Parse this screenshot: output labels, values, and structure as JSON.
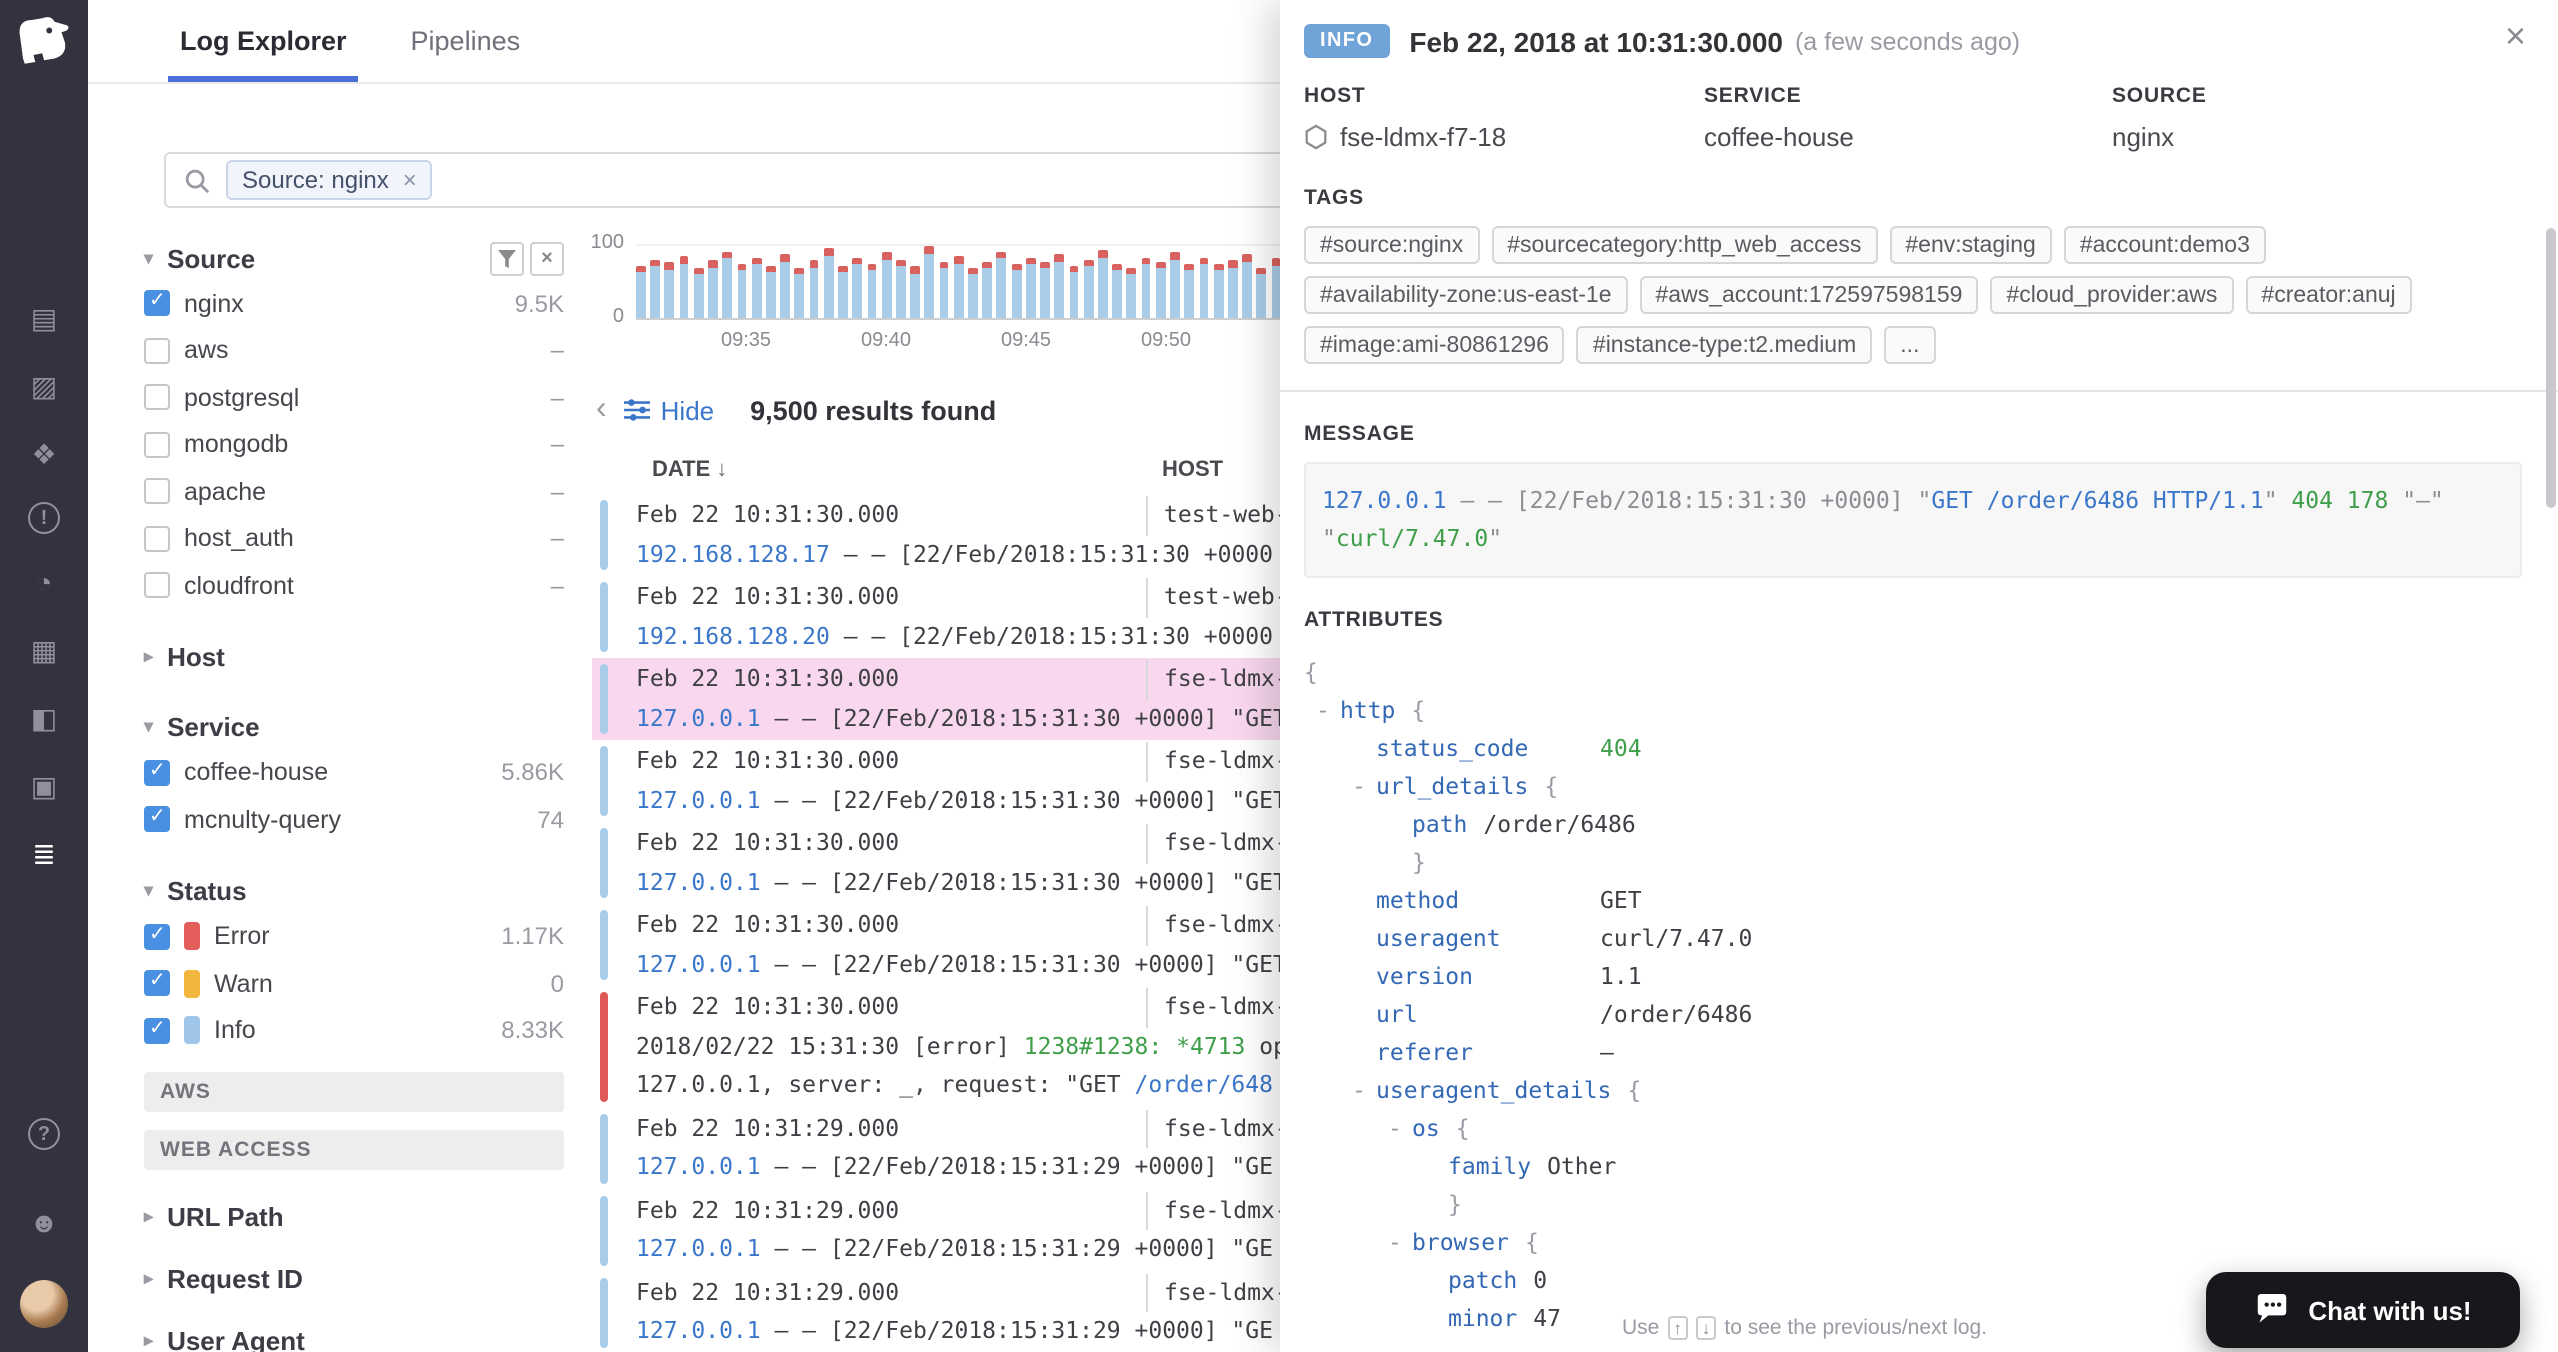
{
  "ui": {
    "chevron_down": "▾",
    "chevron_right": "▸",
    "chevron_left": "‹",
    "close": "×",
    "sort_down": "↓",
    "pill_close": "×",
    "funnel_tooltip": "filter"
  },
  "sidebar": {
    "icons": [
      {
        "name": "boards-icon",
        "glyph": "▤"
      },
      {
        "name": "metrics-icon",
        "glyph": "▨"
      },
      {
        "name": "infrastructure-icon",
        "glyph": "❖"
      },
      {
        "name": "monitors-icon",
        "glyph": "!",
        "circled": true
      },
      {
        "name": "dashboards-icon",
        "glyph": "◔"
      },
      {
        "name": "integrations-icon",
        "glyph": "▦"
      },
      {
        "name": "apm-icon",
        "glyph": "◧"
      },
      {
        "name": "notebooks-icon",
        "glyph": "▣"
      },
      {
        "name": "logs-icon",
        "glyph": "≣",
        "active": true
      }
    ],
    "bottom_icons": [
      {
        "name": "help-icon",
        "glyph": "?",
        "circled": true
      },
      {
        "name": "org-settings-icon",
        "glyph": "☻"
      }
    ]
  },
  "tabs": {
    "log_explorer": "Log Explorer",
    "pipelines": "Pipelines"
  },
  "search": {
    "filter_tag": "Source: nginx"
  },
  "facets": {
    "source": {
      "title": "Source",
      "items": [
        {
          "label": "nginx",
          "count": "9.5K",
          "checked": true
        },
        {
          "label": "aws",
          "count": "–",
          "checked": false
        },
        {
          "label": "postgresql",
          "count": "–",
          "checked": false
        },
        {
          "label": "mongodb",
          "count": "–",
          "checked": false
        },
        {
          "label": "apache",
          "count": "–",
          "checked": false
        },
        {
          "label": "host_auth",
          "count": "–",
          "checked": false
        },
        {
          "label": "cloudfront",
          "count": "–",
          "checked": false
        }
      ]
    },
    "host": {
      "title": "Host"
    },
    "service": {
      "title": "Service",
      "items": [
        {
          "label": "coffee-house",
          "count": "5.86K",
          "checked": true
        },
        {
          "label": "mcnulty-query",
          "count": "74",
          "checked": true
        }
      ]
    },
    "status": {
      "title": "Status",
      "items": [
        {
          "label": "Error",
          "count": "1.17K",
          "checked": true,
          "color": "#e25d5b"
        },
        {
          "label": "Warn",
          "count": "0",
          "checked": true,
          "color": "#f2b63d"
        },
        {
          "label": "Info",
          "count": "8.33K",
          "checked": true,
          "color": "#9fc6e8"
        }
      ]
    },
    "group_aws": "AWS",
    "group_web": "WEB ACCESS",
    "url_path": "URL Path",
    "request_id": "Request ID",
    "user_agent": "User Agent"
  },
  "chart": {
    "type": "bar",
    "y_max": "100",
    "y_min": "0",
    "x_ticks": [
      "09:35",
      "09:40",
      "09:45",
      "09:50"
    ],
    "series": [
      "info",
      "error"
    ],
    "bars": [
      [
        60,
        9
      ],
      [
        68,
        8
      ],
      [
        63,
        10
      ],
      [
        72,
        9
      ],
      [
        58,
        8
      ],
      [
        66,
        10
      ],
      [
        79,
        9
      ],
      [
        64,
        8
      ],
      [
        70,
        10
      ],
      [
        61,
        8
      ],
      [
        74,
        9
      ],
      [
        57,
        8
      ],
      [
        67,
        10
      ],
      [
        82,
        11
      ],
      [
        60,
        8
      ],
      [
        70,
        9
      ],
      [
        64,
        8
      ],
      [
        76,
        10
      ],
      [
        68,
        8
      ],
      [
        59,
        9
      ],
      [
        83,
        11
      ],
      [
        66,
        8
      ],
      [
        72,
        9
      ],
      [
        58,
        8
      ],
      [
        65,
        9
      ],
      [
        78,
        10
      ],
      [
        62,
        8
      ],
      [
        70,
        9
      ],
      [
        66,
        8
      ],
      [
        74,
        10
      ],
      [
        60,
        8
      ],
      [
        68,
        9
      ],
      [
        80,
        10
      ],
      [
        63,
        8
      ],
      [
        58,
        8
      ],
      [
        71,
        9
      ],
      [
        66,
        8
      ],
      [
        76,
        10
      ],
      [
        62,
        8
      ],
      [
        70,
        9
      ],
      [
        64,
        8
      ],
      [
        67,
        9
      ],
      [
        73,
        10
      ],
      [
        59,
        8
      ],
      [
        69,
        9
      ],
      [
        65,
        8
      ]
    ]
  },
  "results": {
    "hide_label": "Hide",
    "count": "9,500 results found",
    "col_date": "DATE",
    "col_host": "HOST"
  },
  "logs": [
    {
      "status": "info",
      "date": "Feb 22 10:31:30.000",
      "host": "test-web-",
      "lines": [
        [
          {
            "t": "192.168.128.17",
            "c": "ip"
          },
          {
            "t": " – – [22/Feb/2018:15:31:30 +0000",
            "c": "plain"
          }
        ]
      ]
    },
    {
      "status": "info",
      "date": "Feb 22 10:31:30.000",
      "host": "test-web-",
      "lines": [
        [
          {
            "t": "192.168.128.20",
            "c": "ip"
          },
          {
            "t": " – – [22/Feb/2018:15:31:30 +0000",
            "c": "plain"
          }
        ]
      ]
    },
    {
      "status": "info",
      "selected": true,
      "date": "Feb 22 10:31:30.000",
      "host": "fse-ldmx-",
      "lines": [
        [
          {
            "t": "127.0.0.1",
            "c": "ip"
          },
          {
            "t": " – – [22/Feb/2018:15:31:30 +0000] \"GET",
            "c": "plain"
          }
        ]
      ]
    },
    {
      "status": "info",
      "date": "Feb 22 10:31:30.000",
      "host": "fse-ldmx-",
      "lines": [
        [
          {
            "t": "127.0.0.1",
            "c": "ip"
          },
          {
            "t": " – – [22/Feb/2018:15:31:30 +0000] \"GET",
            "c": "plain"
          }
        ]
      ]
    },
    {
      "status": "info",
      "date": "Feb 22 10:31:30.000",
      "host": "fse-ldmx-",
      "lines": [
        [
          {
            "t": "127.0.0.1",
            "c": "ip"
          },
          {
            "t": " – – [22/Feb/2018:15:31:30 +0000] \"GET",
            "c": "plain"
          }
        ]
      ]
    },
    {
      "status": "info",
      "date": "Feb 22 10:31:30.000",
      "host": "fse-ldmx-",
      "lines": [
        [
          {
            "t": "127.0.0.1",
            "c": "ip"
          },
          {
            "t": " – – [22/Feb/2018:15:31:30 +0000] \"GET",
            "c": "plain"
          }
        ]
      ]
    },
    {
      "status": "error",
      "date": "Feb 22 10:31:30.000",
      "host": "fse-ldmx-",
      "lines": [
        [
          {
            "t": "2018/02/22 15:31:30 [error] ",
            "c": "plain"
          },
          {
            "t": "1238#1238:",
            "c": "green"
          },
          {
            "t": " ",
            "c": "plain"
          },
          {
            "t": "*4713",
            "c": "green"
          },
          {
            "t": " op",
            "c": "plain"
          }
        ],
        [
          {
            "t": "127.0.0.1",
            "c": "plain"
          },
          {
            "t": ", server: _, request: \"GET ",
            "c": "plain"
          },
          {
            "t": "/order/648",
            "c": "link"
          }
        ]
      ]
    },
    {
      "status": "info",
      "date": "Feb 22 10:31:29.000",
      "host": "fse-ldmx-",
      "lines": [
        [
          {
            "t": "127.0.0.1",
            "c": "ip"
          },
          {
            "t": " – – [22/Feb/2018:15:31:29 +0000] \"GE",
            "c": "plain"
          }
        ]
      ]
    },
    {
      "status": "info",
      "date": "Feb 22 10:31:29.000",
      "host": "fse-ldmx-",
      "lines": [
        [
          {
            "t": "127.0.0.1",
            "c": "ip"
          },
          {
            "t": " – – [22/Feb/2018:15:31:29 +0000] \"GE",
            "c": "plain"
          }
        ]
      ]
    },
    {
      "status": "info",
      "date": "Feb 22 10:31:29.000",
      "host": "fse-ldmx-",
      "lines": [
        [
          {
            "t": "127.0.0.1",
            "c": "ip"
          },
          {
            "t": " – – [22/Feb/2018:15:31:29 +0000] \"GE",
            "c": "plain"
          }
        ]
      ]
    }
  ],
  "detail": {
    "level_badge": "INFO",
    "timestamp": "Feb 22, 2018 at 10:31:30.000",
    "relative_time": "(a few seconds ago)",
    "meta": {
      "host_label": "HOST",
      "host": "fse-ldmx-f7-18",
      "service_label": "SERVICE",
      "service": "coffee-house",
      "source_label": "SOURCE",
      "source": "nginx"
    },
    "tags_label": "TAGS",
    "tags": [
      "#source:nginx",
      "#sourcecategory:http_web_access",
      "#env:staging",
      "#account:demo3",
      "#availability-zone:us-east-1e",
      "#aws_account:172597598159",
      "#cloud_provider:aws",
      "#creator:anuj",
      "#image:ami-80861296",
      "#instance-type:t2.medium",
      "..."
    ],
    "message_label": "MESSAGE",
    "message_segments": [
      {
        "t": "127.0.0.1",
        "c": "ip"
      },
      {
        "t": " – – ",
        "c": "dim"
      },
      {
        "t": "[22/Feb/2018:15:31:30 +0000]",
        "c": "dim"
      },
      {
        "t": " \"",
        "c": "dim"
      },
      {
        "t": "GET /order/6486 HTTP/1.1",
        "c": "link"
      },
      {
        "t": "\" ",
        "c": "dim"
      },
      {
        "t": "404 178",
        "c": "num"
      },
      {
        "t": " \"–\" \"",
        "c": "dim"
      },
      {
        "t": "curl/7.47.0",
        "c": "num"
      },
      {
        "t": "\"",
        "c": "dim"
      }
    ],
    "attributes_label": "ATTRIBUTES",
    "attributes": [
      {
        "indent": 0,
        "punct": "{"
      },
      {
        "indent": 1,
        "toggle": true,
        "key": "http",
        "open": "{"
      },
      {
        "indent": 2,
        "key": "status_code",
        "val": "404",
        "vc": "num",
        "col": true
      },
      {
        "indent": 2,
        "toggle": true,
        "key": "url_details",
        "open": "{"
      },
      {
        "indent": 3,
        "key": "path",
        "val": "/order/6486"
      },
      {
        "indent": 3,
        "punct": "}"
      },
      {
        "indent": 2,
        "key": "method",
        "val": "GET",
        "col": true
      },
      {
        "indent": 2,
        "key": "useragent",
        "val": "curl/7.47.0",
        "col": true
      },
      {
        "indent": 2,
        "key": "version",
        "val": "1.1",
        "col": true
      },
      {
        "indent": 2,
        "key": "url",
        "val": "/order/6486",
        "col": true
      },
      {
        "indent": 2,
        "key": "referer",
        "val": "–",
        "col": true
      },
      {
        "indent": 2,
        "toggle": true,
        "key": "useragent_details",
        "open": "{"
      },
      {
        "indent": 3,
        "toggle": true,
        "key": "os",
        "open": "{"
      },
      {
        "indent": 4,
        "key": "family",
        "val": "Other"
      },
      {
        "indent": 4,
        "punct": "}"
      },
      {
        "indent": 3,
        "toggle": true,
        "key": "browser",
        "open": "{"
      },
      {
        "indent": 4,
        "key": "patch",
        "val": "0"
      },
      {
        "indent": 4,
        "key": "minor",
        "val": "47"
      }
    ]
  },
  "hint": {
    "prefix": "Use",
    "key_up": "↑",
    "key_down": "↓",
    "suffix": "to see the previous/next log."
  },
  "chat": {
    "label": "Chat with us!"
  }
}
